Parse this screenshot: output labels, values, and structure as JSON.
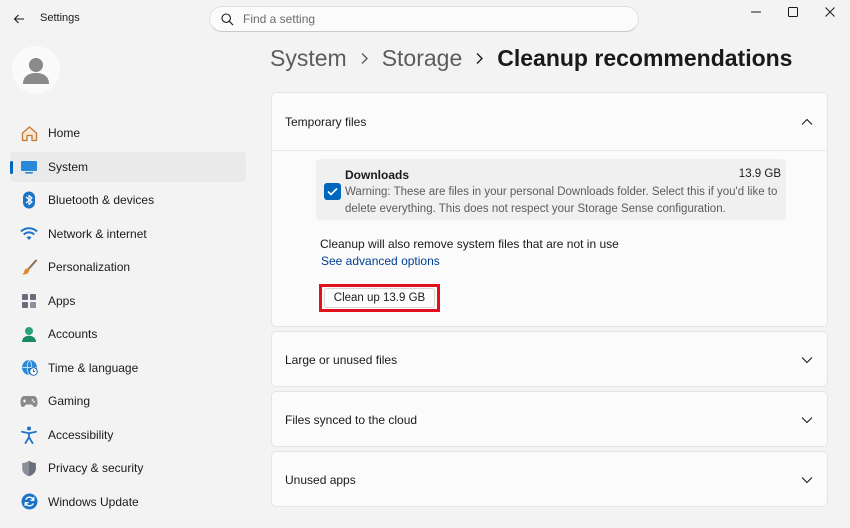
{
  "window": {
    "title": "Settings",
    "search_placeholder": "Find a setting"
  },
  "sidebar": {
    "items": [
      {
        "label": "Home",
        "icon": "home-icon"
      },
      {
        "label": "System",
        "icon": "system-icon",
        "active": true
      },
      {
        "label": "Bluetooth & devices",
        "icon": "bluetooth-icon"
      },
      {
        "label": "Network & internet",
        "icon": "wifi-icon"
      },
      {
        "label": "Personalization",
        "icon": "brush-icon"
      },
      {
        "label": "Apps",
        "icon": "apps-icon"
      },
      {
        "label": "Accounts",
        "icon": "accounts-icon"
      },
      {
        "label": "Time & language",
        "icon": "globe-clock-icon"
      },
      {
        "label": "Gaming",
        "icon": "gamepad-icon"
      },
      {
        "label": "Accessibility",
        "icon": "accessibility-icon"
      },
      {
        "label": "Privacy & security",
        "icon": "shield-icon"
      },
      {
        "label": "Windows Update",
        "icon": "update-icon"
      }
    ]
  },
  "breadcrumb": {
    "items": [
      "System",
      "Storage"
    ],
    "current": "Cleanup recommendations"
  },
  "sections": {
    "temporary": {
      "title": "Temporary files",
      "file": {
        "name": "Downloads",
        "size": "13.9 GB",
        "description": "Warning: These are files in your personal Downloads folder. Select this if you'd like to delete everything. This does not respect your Storage Sense configuration.",
        "checked": true
      },
      "info": "Cleanup will also remove system files that are not in use",
      "advanced_link": "See advanced options",
      "button_label": "Clean up 13.9 GB"
    },
    "large": {
      "title": "Large or unused files"
    },
    "cloud": {
      "title": "Files synced to the cloud"
    },
    "unused_apps": {
      "title": "Unused apps"
    }
  },
  "colors": {
    "accent": "#0067c0",
    "highlight_border": "#e0101c",
    "link": "#003e92"
  }
}
